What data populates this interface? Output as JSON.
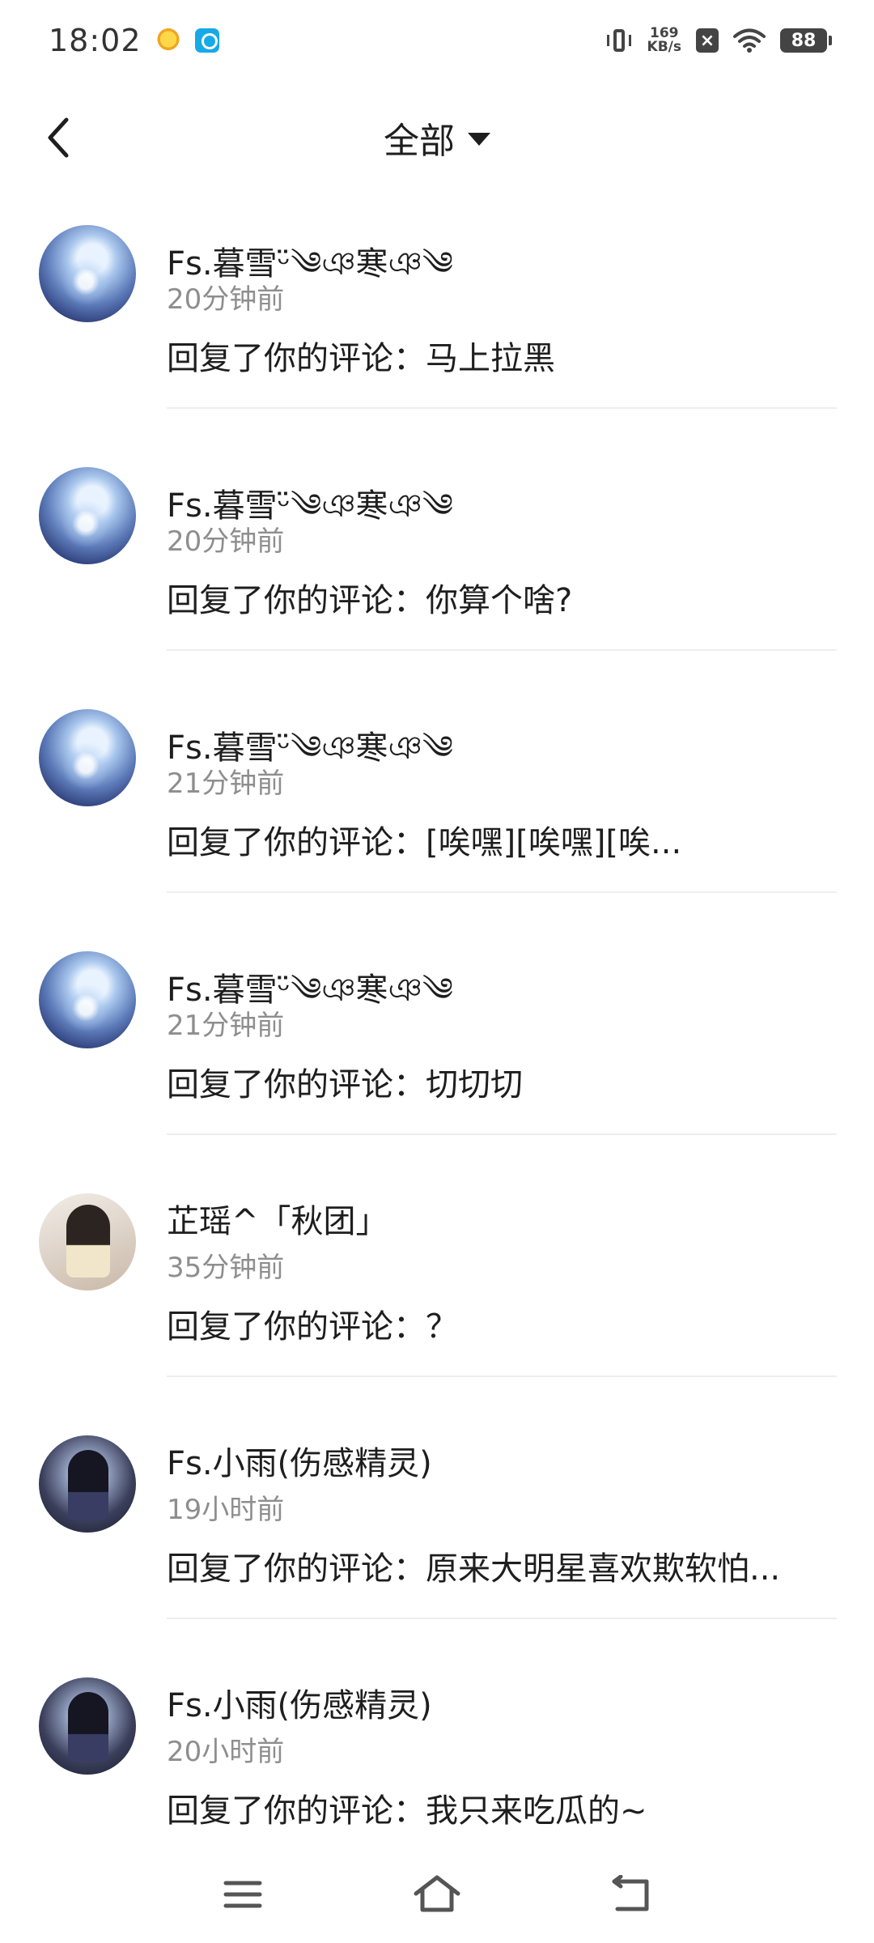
{
  "status_bar": {
    "time": "18:02",
    "speed_value": "169",
    "speed_unit": "KB/s",
    "battery": "88"
  },
  "header": {
    "title": "全部"
  },
  "notifications": [
    {
      "username": "Fs.暮雪ᵕ̈༄ঞ寒ঞ༄",
      "time_ago": "20分钟前",
      "text": "回复了你的评论：马上拉黑"
    },
    {
      "username": "Fs.暮雪ᵕ̈༄ঞ寒ঞ༄",
      "time_ago": "20分钟前",
      "text": "回复了你的评论：你算个啥?"
    },
    {
      "username": "Fs.暮雪ᵕ̈༄ঞ寒ঞ༄",
      "time_ago": "21分钟前",
      "text": "回复了你的评论：[唉嘿][唉嘿][唉..."
    },
    {
      "username": "Fs.暮雪ᵕ̈༄ঞ寒ঞ༄",
      "time_ago": "21分钟前",
      "text": "回复了你的评论：切切切"
    },
    {
      "username": "芷瑶^「秋团」",
      "time_ago": "35分钟前",
      "text": "回复了你的评论：？"
    },
    {
      "username": "Fs.小雨(伤感精灵)",
      "time_ago": "19小时前",
      "text": "回复了你的评论：原来大明星喜欢欺软怕..."
    },
    {
      "username": "Fs.小雨(伤感精灵)",
      "time_ago": "20小时前",
      "text": "回复了你的评论：我只来吃瓜的~"
    }
  ]
}
